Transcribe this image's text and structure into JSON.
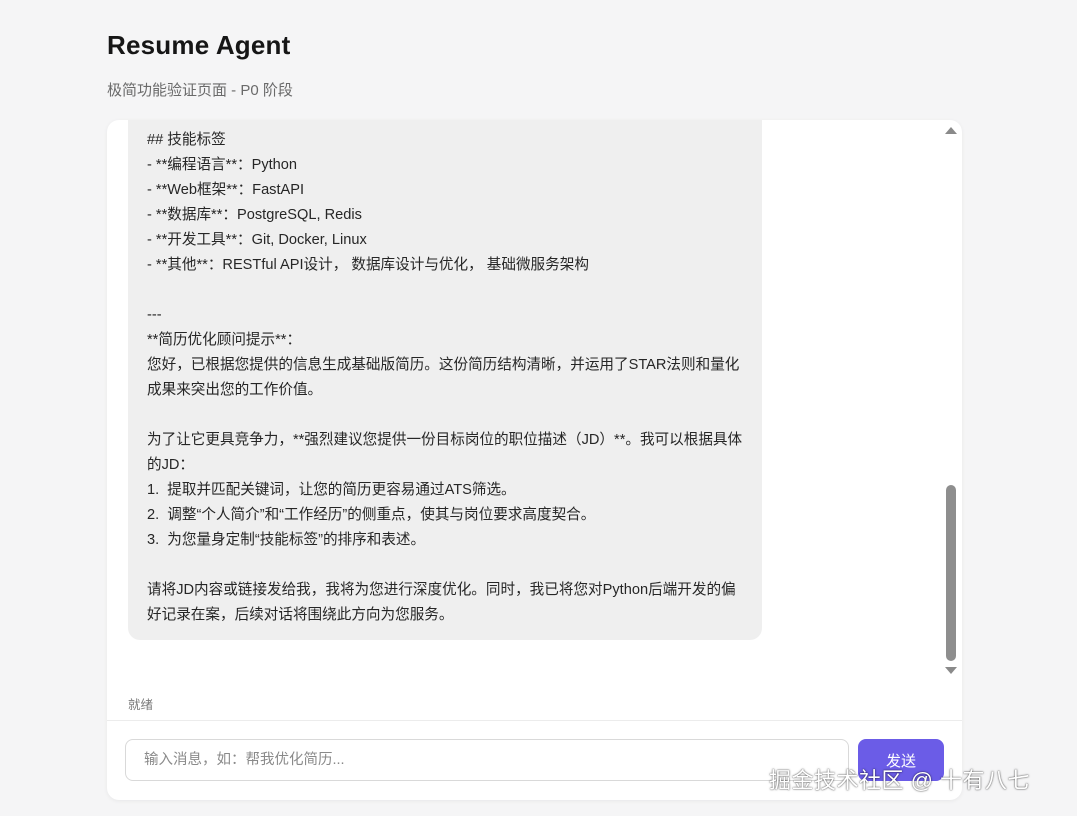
{
  "header": {
    "title": "Resume Agent",
    "subtitle": "极简功能验证页面 - P0 阶段"
  },
  "chat": {
    "message_lines": [
      "## 技能标签",
      "- **编程语言**：Python",
      "- **Web框架**：FastAPI",
      "- **数据库**：PostgreSQL, Redis",
      "- **开发工具**：Git, Docker, Linux",
      "- **其他**：RESTful API设计， 数据库设计与优化， 基础微服务架构",
      "",
      "---",
      "**简历优化顾问提示**：",
      "您好，已根据您提供的信息生成基础版简历。这份简历结构清晰，并运用了STAR法则和量化成果来突出您的工作价值。",
      "",
      "为了让它更具竞争力，**强烈建议您提供一份目标岗位的职位描述（JD）**。我可以根据具体的JD：",
      "1.  提取并匹配关键词，让您的简历更容易通过ATS筛选。",
      "2.  调整“个人简介”和“工作经历”的侧重点，使其与岗位要求高度契合。",
      "3.  为您量身定制“技能标签”的排序和表述。",
      "",
      "请将JD内容或链接发给我，我将为您进行深度优化。同时，我已将您对Python后端开发的偏好记录在案，后续对话将围绕此方向为您服务。"
    ],
    "scroll_position": 0.85
  },
  "status": {
    "text": "就绪"
  },
  "composer": {
    "placeholder": "输入消息，如：帮我优化简历...",
    "value": "",
    "send_label": "发送"
  },
  "watermark": {
    "text": "掘金技术社区 @ 十有八七"
  },
  "colors": {
    "accent": "#6b5ce7",
    "bubble_bg": "#efefef",
    "page_bg": "#f5f5f6"
  }
}
